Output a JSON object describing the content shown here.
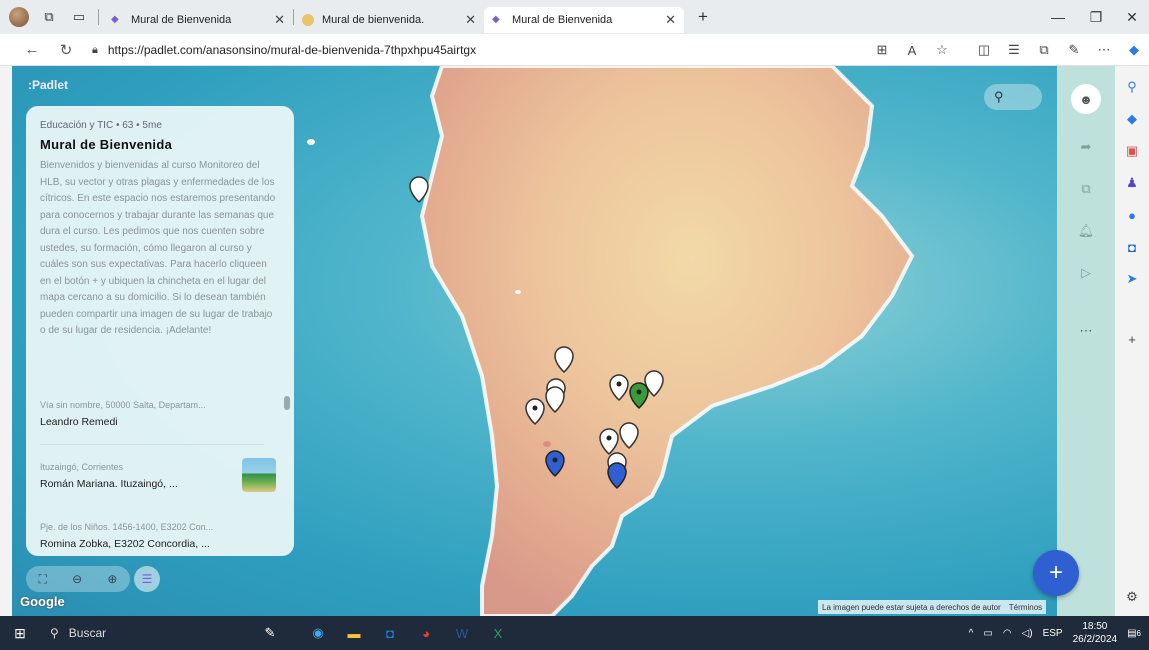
{
  "browser": {
    "tabs": [
      {
        "label": "Mural de Bienvenida",
        "active": false
      },
      {
        "label": "Mural de bienvenida.",
        "active": false
      },
      {
        "label": "Mural de Bienvenida",
        "active": true
      }
    ],
    "url": "https://padlet.com/anasonsino/mural-de-bienvenida-7thpxhpu45airtgx"
  },
  "padlet": {
    "logo": ":Padlet",
    "meta": "Educación y TIC • 63 • 5me",
    "title": "Mural de Bienvenida",
    "description": "Bienvenidos y bienvenidas al curso Monitoreo del HLB, su vector y otras plagas y enfermedades de los cítricos. En este espacio nos estaremos presentando para conocernos y trabajar durante las semanas que dura el curso. Les pedimos que nos cuenten sobre ustedes, su formación, cómo llegaron al curso y cuáles son sus expectativas. Para hacerlo cliqueen en el botón + y ubiquen la chincheta en el lugar del mapa cercano a su domicilio. Si lo desean también pueden compartir una imagen de su lugar de trabajo o de su lugar de residencia. ¡Adelante!",
    "posts": [
      {
        "address": "Vía sin nombre, 50000 Salta, Departam...",
        "name": "Leandro Remedi"
      },
      {
        "address": "Ituzaingó, Corrientes",
        "name": "Román Mariana. Ituzaingó, ..."
      },
      {
        "address": "Pje. de los Niños. 1456-1400, E3202 Con...",
        "name": "Romina Zobka, E3202 Concordia, ..."
      }
    ],
    "map_footer": {
      "copyright": "La imagen puede estar sujeta a derechos de autor",
      "terms": "Términos"
    },
    "google": "Google"
  },
  "taskbar": {
    "search": "Buscar",
    "lang": "ESP",
    "time": "18:50",
    "date": "26/2/2024",
    "notifications": "6"
  },
  "colors": {
    "fab": "#2f5fd0",
    "pin_white": "#ffffff",
    "pin_green": "#3b9a3b",
    "pin_blue": "#2f5fd0"
  }
}
